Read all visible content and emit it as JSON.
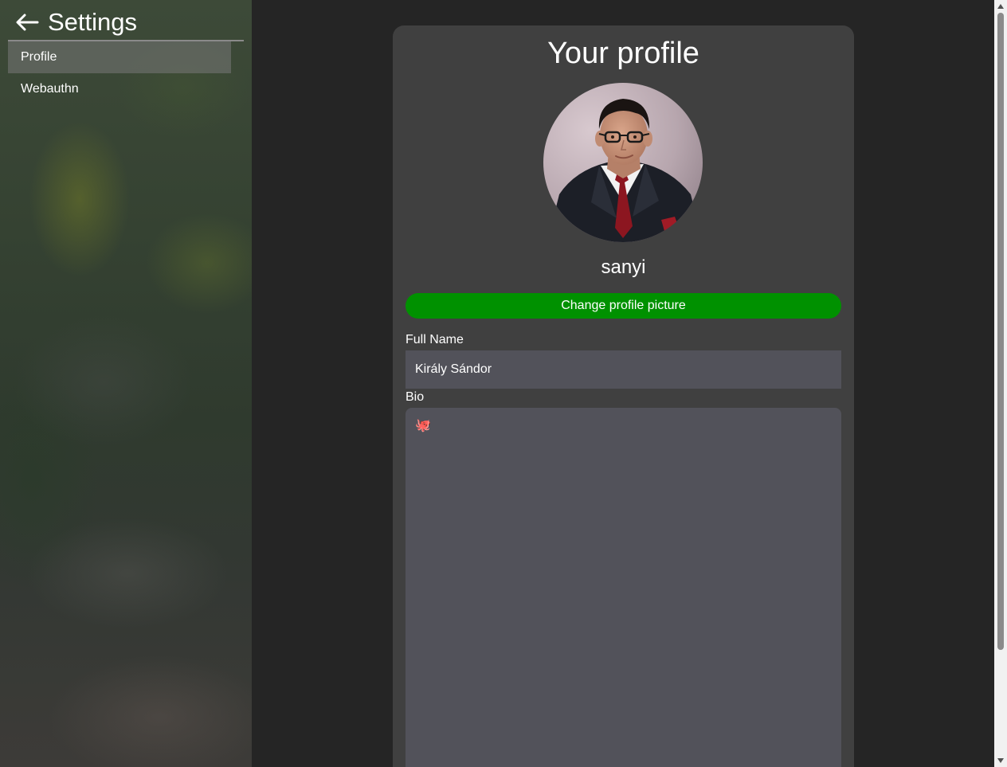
{
  "sidebar": {
    "back_icon": "arrow-left-icon",
    "title": "Settings",
    "items": [
      {
        "label": "Profile",
        "active": true
      },
      {
        "label": "Webauthn",
        "active": false
      }
    ]
  },
  "profile": {
    "title": "Your profile",
    "avatar_alt": "profile-photo",
    "username": "sanyi",
    "change_picture_label": "Change profile picture",
    "full_name_label": "Full Name",
    "full_name_value": "Király Sándor",
    "bio_label": "Bio",
    "bio_value": "🐙"
  },
  "colors": {
    "accent_green": "#009100",
    "card_bg": "#404040",
    "input_bg": "#52525a",
    "page_bg": "#252525"
  },
  "scrollbar": {
    "up_icon": "scroll-up-arrow-icon",
    "down_icon": "scroll-down-arrow-icon"
  }
}
